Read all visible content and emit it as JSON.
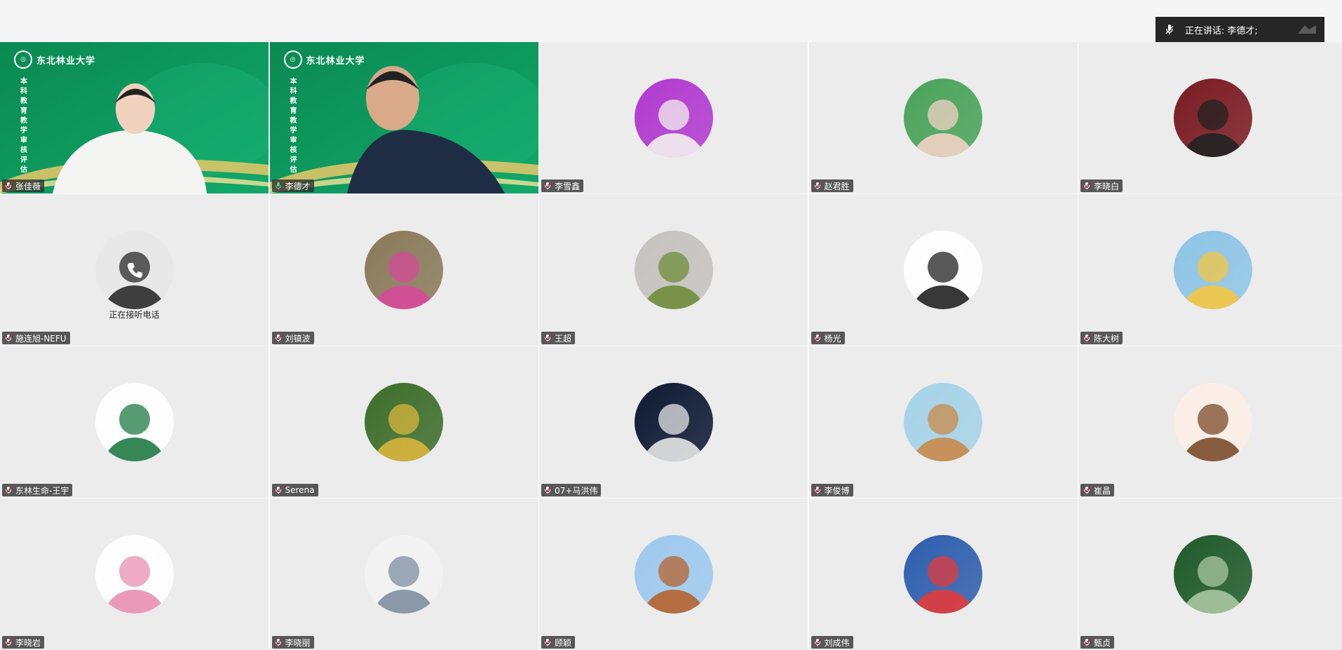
{
  "speaking_bar": {
    "label": "正在讲话: ",
    "speaker": "李德才;"
  },
  "participants": [
    {
      "name": "张佳薇",
      "kind": "video",
      "mic": "muted"
    },
    {
      "name": "李德才",
      "kind": "video",
      "mic": "speaking",
      "active": true
    },
    {
      "name": "李雪鑫",
      "kind": "avatar",
      "mic": "muted",
      "avatar_colors": [
        "#b23ad0",
        "#f3f0ee"
      ]
    },
    {
      "name": "赵君胜",
      "kind": "avatar",
      "mic": "muted",
      "avatar_colors": [
        "#4aa35a",
        "#f1d3c4"
      ]
    },
    {
      "name": "李晓白",
      "kind": "avatar",
      "mic": "muted",
      "avatar_colors": [
        "#7a1b22",
        "#222222"
      ]
    },
    {
      "name": "施连旭-NEFU",
      "kind": "avatar",
      "mic": "muted",
      "avatar_colors": [
        "#e8e8e8",
        "#2b2b2b"
      ],
      "note": "正在接听电话"
    },
    {
      "name": "刘镇波",
      "kind": "avatar",
      "mic": "muted",
      "avatar_colors": [
        "#8a7a5a",
        "#d64a9a"
      ]
    },
    {
      "name": "王超",
      "kind": "avatar",
      "mic": "muted",
      "avatar_colors": [
        "#c6c3bf",
        "#6f8d3b"
      ]
    },
    {
      "name": "杨光",
      "kind": "avatar",
      "mic": "muted",
      "avatar_colors": [
        "#ffffff",
        "#222222"
      ]
    },
    {
      "name": "陈大树",
      "kind": "avatar",
      "mic": "muted",
      "avatar_colors": [
        "#8ec5e6",
        "#f4c542"
      ]
    },
    {
      "name": "东林生命-王宇",
      "kind": "avatar",
      "mic": "muted",
      "avatar_colors": [
        "#ffffff",
        "#1f7a44"
      ]
    },
    {
      "name": "Serena",
      "kind": "avatar",
      "mic": "muted",
      "avatar_colors": [
        "#3d6e2b",
        "#d9b53c"
      ]
    },
    {
      "name": "07+马洪伟",
      "kind": "avatar",
      "mic": "muted",
      "avatar_colors": [
        "#0d1a33",
        "#e6e6e6"
      ]
    },
    {
      "name": "李俊博",
      "kind": "avatar",
      "mic": "muted",
      "avatar_colors": [
        "#a6d3e8",
        "#c98a4a"
      ]
    },
    {
      "name": "崔晶",
      "kind": "avatar",
      "mic": "muted",
      "avatar_colors": [
        "#fbeee6",
        "#7a4a2a"
      ]
    },
    {
      "name": "李晓岩",
      "kind": "avatar",
      "mic": "muted",
      "avatar_colors": [
        "#ffffff",
        "#e88fb0"
      ]
    },
    {
      "name": "李晓丽",
      "kind": "avatar",
      "mic": "muted",
      "avatar_colors": [
        "#f2f2f2",
        "#7e8ea0"
      ]
    },
    {
      "name": "顾颖",
      "kind": "avatar",
      "mic": "muted",
      "avatar_colors": [
        "#9ec9ee",
        "#b6642f"
      ]
    },
    {
      "name": "刘成伟",
      "kind": "avatar",
      "mic": "muted",
      "avatar_colors": [
        "#2f5fae",
        "#e23b3b"
      ]
    },
    {
      "name": "甄贞",
      "kind": "avatar",
      "mic": "muted",
      "avatar_colors": [
        "#1f5a2a",
        "#a9c7a0"
      ]
    }
  ],
  "video_overlay": {
    "university_logo_text": "东北林业大学",
    "vertical_banner": "本科教育教学审核评估"
  },
  "colors": {
    "video_green": "#0d9b5f",
    "tile_bg": "#ececec",
    "active_border": "#4fd29a",
    "speaking_bar_bg": "#262626"
  }
}
